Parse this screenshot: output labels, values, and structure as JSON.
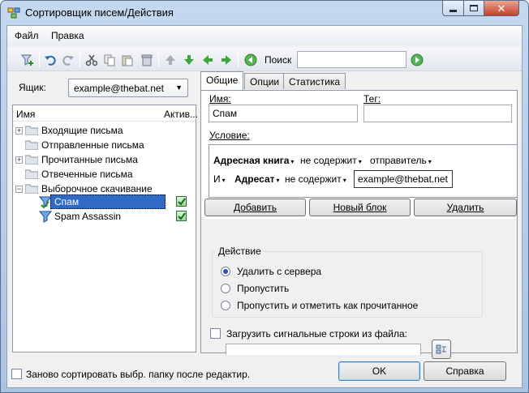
{
  "window": {
    "title": "Сортировщик писем/Действия",
    "controls": [
      "minimize-icon",
      "maximize-icon",
      "close-icon"
    ]
  },
  "menu": [
    "Файл",
    "Правка"
  ],
  "toolbar": {
    "icons": [
      "new-filter-icon",
      "undo-icon",
      "redo-icon",
      "cut-icon",
      "copy-icon",
      "paste-icon",
      "delete-icon",
      "move-up-icon",
      "move-down-icon",
      "move-left-icon",
      "move-right-icon",
      "search-back-icon",
      "search-forward-icon"
    ],
    "search_label": "Поиск",
    "search_value": ""
  },
  "folder_selector": {
    "label": "Ящик:",
    "value": "example@thebat.net"
  },
  "tree": {
    "col_name": "Имя",
    "col_active": "Актив...",
    "folders": [
      {
        "name": "Входящие письма",
        "expandable": true
      },
      {
        "name": "Отправленные письма",
        "expandable": false
      },
      {
        "name": "Прочитанные письма",
        "expandable": true
      },
      {
        "name": "Отвеченные письма",
        "expandable": false
      },
      {
        "name": "Выборочное скачивание",
        "expandable": true,
        "expanded": true
      }
    ],
    "filters": [
      {
        "name": "Спам",
        "active": true,
        "selected": true
      },
      {
        "name": "Spam Assassin",
        "active": true,
        "selected": false
      }
    ]
  },
  "tabs": [
    "Общие",
    "Опции",
    "Статистика"
  ],
  "active_tab": "Общие",
  "general": {
    "name_label": "Имя:",
    "name_value": "Спам",
    "tag_label": "Тег:",
    "tag_value": "",
    "condition_label": "Условие:",
    "condition_rows": [
      {
        "prefix": "",
        "field": "Адресная книга",
        "operator": "не содержит",
        "value": "отправитель"
      },
      {
        "prefix": "И",
        "field": "Адресат",
        "operator": "не содержит",
        "value": "example@thebat.net"
      }
    ],
    "buttons": {
      "add": "Добавить",
      "new_block": "Новый блок",
      "delete": "Удалить"
    },
    "action": {
      "title": "Действие",
      "options": [
        "Удалить с сервера",
        "Пропустить",
        "Пропустить и отметить как прочитанное"
      ],
      "selected": "Удалить с сервера"
    },
    "load_lines": {
      "label": "Загрузить сигнальные строки из файла:",
      "checked": false,
      "path": ""
    }
  },
  "footer": {
    "resort_label": "Заново сортировать выбр. папку после редактир.",
    "resort_checked": false,
    "ok": "OK",
    "help": "Справка"
  }
}
